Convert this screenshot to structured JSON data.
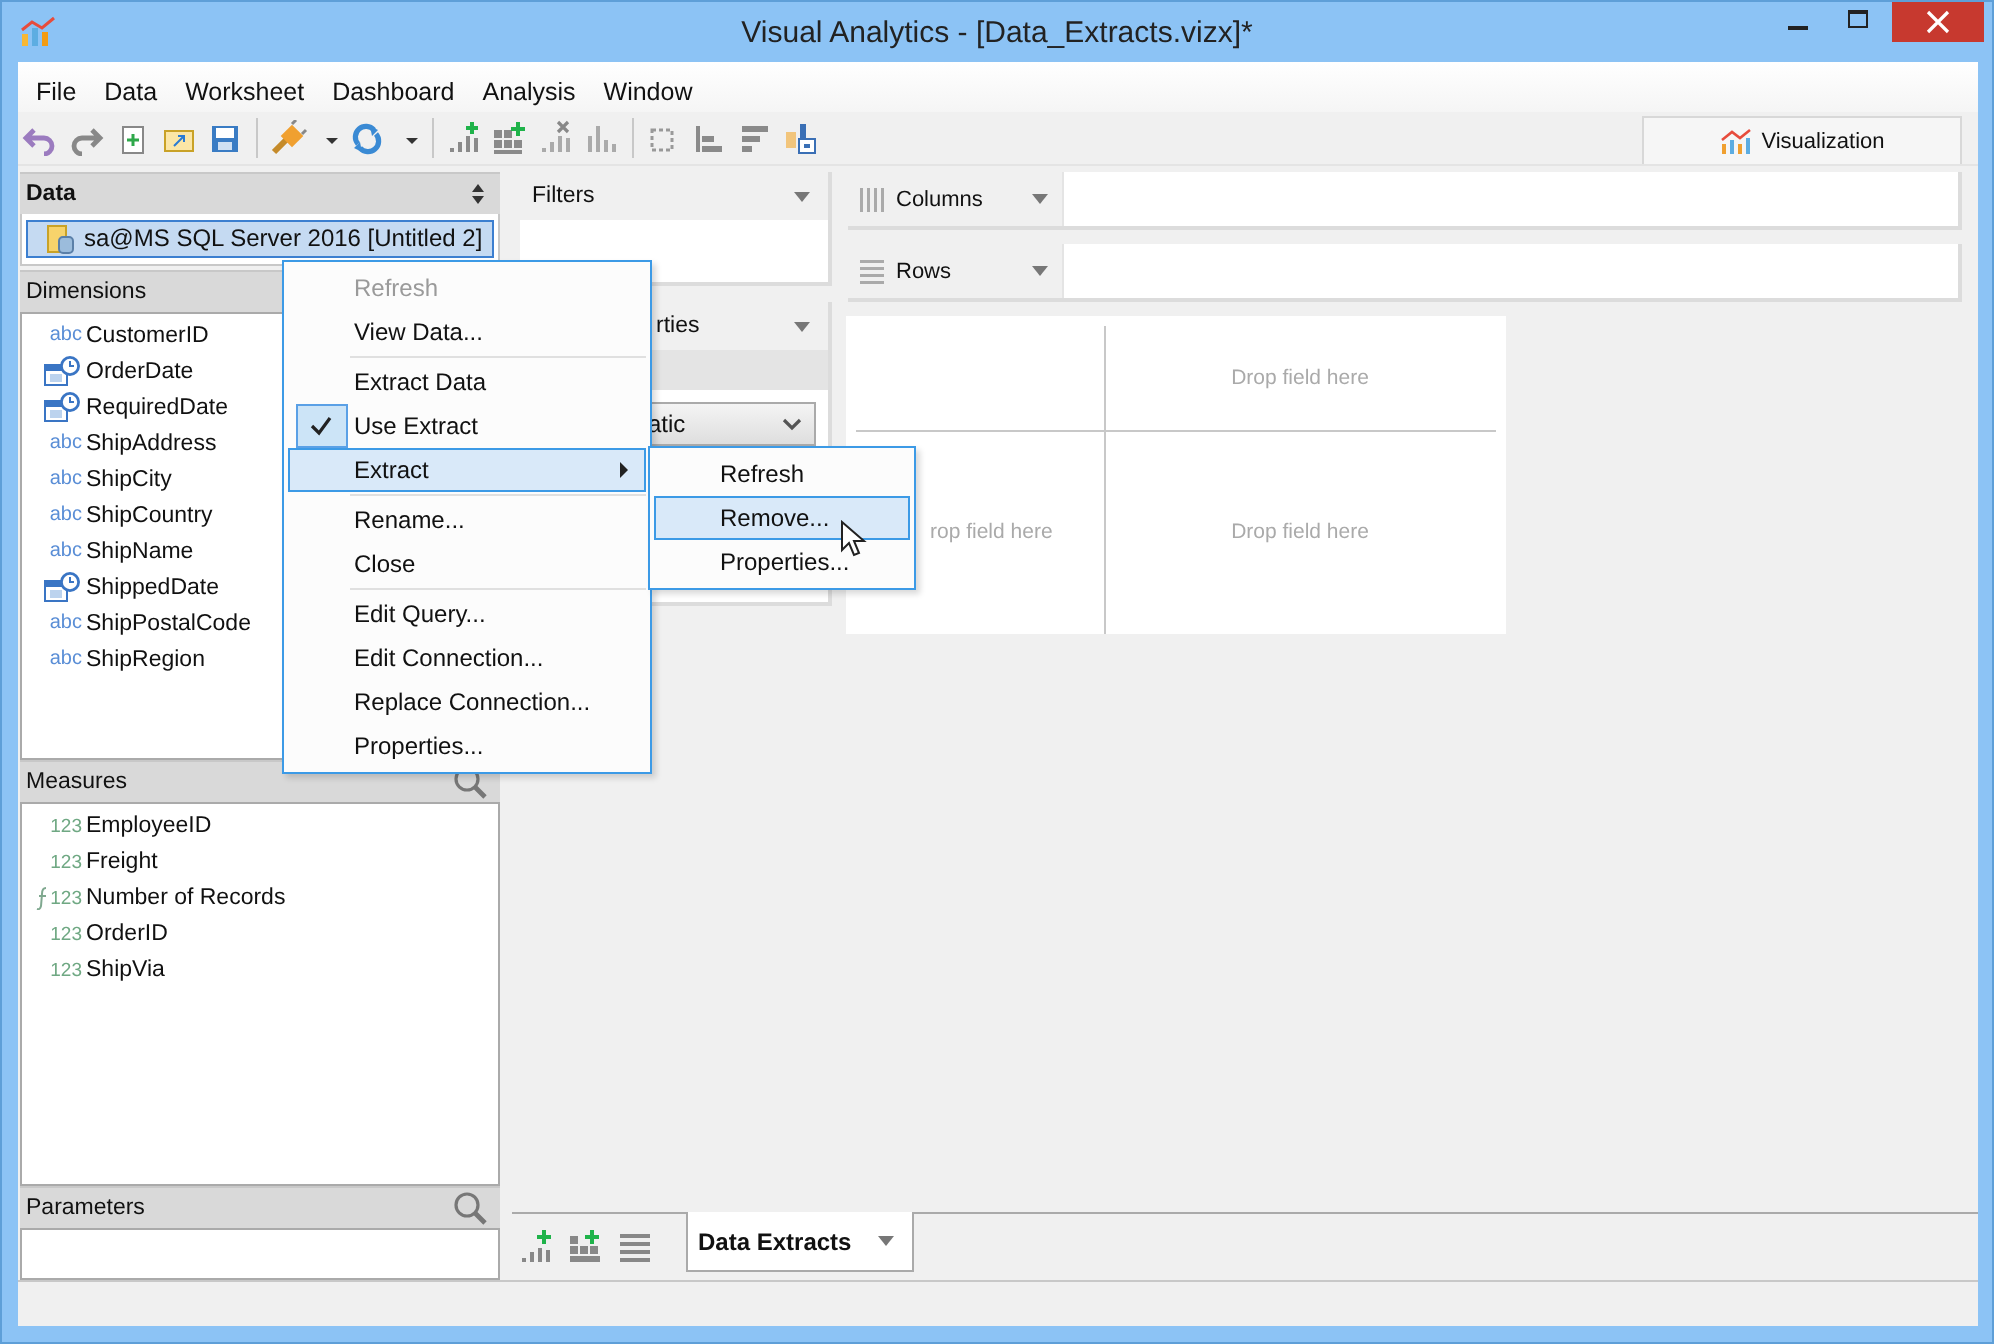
{
  "window": {
    "title": "Visual Analytics - [Data_Extracts.vizx]*"
  },
  "menu_bar": [
    "File",
    "Data",
    "Worksheet",
    "Dashboard",
    "Analysis",
    "Window"
  ],
  "view_tab": {
    "label": "Visualization"
  },
  "data_pane": {
    "title": "Data",
    "connection": {
      "label": "sa@MS SQL Server 2016 [Untitled 2]",
      "selected": true
    }
  },
  "dimensions": {
    "title": "Dimensions",
    "fields": [
      {
        "name": "CustomerID",
        "kind": "text",
        "type_label": "abc"
      },
      {
        "name": "OrderDate",
        "kind": "date"
      },
      {
        "name": "RequiredDate",
        "kind": "date"
      },
      {
        "name": "ShipAddress",
        "kind": "text",
        "type_label": "abc"
      },
      {
        "name": "ShipCity",
        "kind": "text",
        "type_label": "abc"
      },
      {
        "name": "ShipCountry",
        "kind": "text",
        "type_label": "abc"
      },
      {
        "name": "ShipName",
        "kind": "text",
        "type_label": "abc"
      },
      {
        "name": "ShippedDate",
        "kind": "date"
      },
      {
        "name": "ShipPostalCode",
        "kind": "text",
        "type_label": "abc"
      },
      {
        "name": "ShipRegion",
        "kind": "text",
        "type_label": "abc"
      }
    ]
  },
  "measures": {
    "title": "Measures",
    "fields": [
      {
        "name": "EmployeeID",
        "kind": "number",
        "type_label": "123"
      },
      {
        "name": "Freight",
        "kind": "number",
        "type_label": "123"
      },
      {
        "name": "Number of Records",
        "kind": "calculated",
        "type_label": "123"
      },
      {
        "name": "OrderID",
        "kind": "number",
        "type_label": "123"
      },
      {
        "name": "ShipVia",
        "kind": "number",
        "type_label": "123"
      }
    ]
  },
  "parameters": {
    "title": "Parameters"
  },
  "filters": {
    "title": "Filters"
  },
  "properties_card": {
    "title": "rties",
    "dropdown": "atic"
  },
  "shelves": [
    {
      "label": "Columns",
      "kind": "columns"
    },
    {
      "label": "Rows",
      "kind": "rows"
    }
  ],
  "canvas": {
    "placeholders": [
      "Drop field here",
      "rop field here",
      "Drop field here"
    ]
  },
  "sheet_tabs": [
    {
      "label": "Data Extracts",
      "selected": true
    }
  ],
  "context_menu": {
    "items": [
      {
        "kind": "item",
        "label": "Refresh",
        "disabled": true,
        "checked": false,
        "selected": false
      },
      {
        "kind": "item",
        "label": "View Data...",
        "disabled": false,
        "checked": false,
        "selected": false
      },
      {
        "kind": "separator"
      },
      {
        "kind": "item",
        "label": "Extract Data",
        "disabled": false,
        "checked": false,
        "selected": false
      },
      {
        "kind": "item",
        "label": "Use Extract",
        "disabled": false,
        "checked": true,
        "selected": false
      },
      {
        "kind": "submenu",
        "label": "Extract",
        "disabled": false,
        "checked": false,
        "selected": true
      },
      {
        "kind": "separator"
      },
      {
        "kind": "item",
        "label": "Rename...",
        "disabled": false,
        "checked": false,
        "selected": false
      },
      {
        "kind": "item",
        "label": "Close",
        "disabled": false,
        "checked": false,
        "selected": false
      },
      {
        "kind": "separator"
      },
      {
        "kind": "item",
        "label": "Edit Query...",
        "disabled": false,
        "checked": false,
        "selected": false
      },
      {
        "kind": "item",
        "label": "Edit Connection...",
        "disabled": false,
        "checked": false,
        "selected": false
      },
      {
        "kind": "item",
        "label": "Replace Connection...",
        "disabled": false,
        "checked": false,
        "selected": false
      },
      {
        "kind": "item",
        "label": "Properties...",
        "disabled": false,
        "checked": false,
        "selected": false
      }
    ]
  },
  "submenu": {
    "items": [
      {
        "label": "Refresh",
        "selected": false
      },
      {
        "label": "Remove...",
        "selected": true
      },
      {
        "label": "Properties...",
        "selected": false
      }
    ]
  }
}
